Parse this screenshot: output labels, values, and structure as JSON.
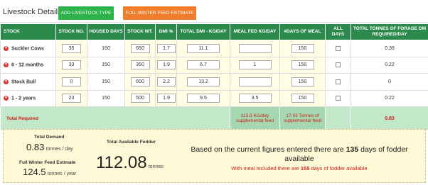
{
  "header": {
    "title": "Livestock Details",
    "add_button": "ADD LIVESTOCK TYPE",
    "estimate_button": "FULL WINTER FEED ESTIMATE"
  },
  "columns": [
    "STOCK",
    "STOCK NO.",
    "HOUSED DAYS",
    "STOCK WT.",
    "DMI %",
    "TOTAL DMI - KG/DAY",
    "MEAL FED KG/DAY",
    "#DAYS OF MEAL",
    "ALL DAYS",
    "TOTAL TONNES OF FORAGE DM REQUIRED/DAY"
  ],
  "rows": [
    {
      "stock": "Suckler Cows",
      "stock_no": "35",
      "housed_days": "150",
      "stock_wt": "650",
      "dmi": "1.7",
      "total_dmi": "11.1",
      "meal_fed": "",
      "days_of_meal": "150",
      "total_tonnes": "0.39"
    },
    {
      "stock": "6 - 12 months",
      "stock_no": "33",
      "housed_days": "150",
      "stock_wt": "350",
      "dmi": "1.9",
      "total_dmi": "6.7",
      "meal_fed": "1",
      "days_of_meal": "150",
      "total_tonnes": "0.22"
    },
    {
      "stock": "Stock Bull",
      "stock_no": "0",
      "housed_days": "150",
      "stock_wt": "600",
      "dmi": "2.2",
      "total_dmi": "13.2",
      "meal_fed": "",
      "days_of_meal": "150",
      "total_tonnes": "0"
    },
    {
      "stock": "1 - 2 years",
      "stock_no": "23",
      "housed_days": "150",
      "stock_wt": "500",
      "dmi": "1.9",
      "total_dmi": "9.5",
      "meal_fed": "3.5",
      "days_of_meal": "150",
      "total_tonnes": "0.22"
    }
  ],
  "totals": {
    "label": "Total Required",
    "meal_supplement": "113.5 KG/day supplemental feed",
    "days_supplement": "17.03 Tonnes of supplemental feed",
    "total_tonnes": "0.83"
  },
  "summary": {
    "demand_label": "Total Demand",
    "demand_value": "0.83",
    "demand_unit": "tonnes / day",
    "estimate_label": "Full Winter Feed Estimate",
    "estimate_value": "124.5",
    "estimate_unit": "tonnes / year",
    "fodder_label": "Total Available Fodder",
    "fodder_value": "112.08",
    "fodder_unit": "tonnes",
    "msg_prefix": "Based on the current figures entered there are",
    "msg_days": "135",
    "msg_suffix": "days of fodder available",
    "sub_prefix": "With meal included there are",
    "sub_days": "155",
    "sub_suffix": "days of fodder available"
  },
  "colors": {
    "header_green": "#2c8a4c",
    "add_button": "#2db34a",
    "estimate_button": "#f07d2b",
    "alert_red": "#d21b1b",
    "total_row": "#c0e8c9",
    "summary_bg": "#fdf9d6"
  },
  "icons": {
    "row_delete": "remove-circle-icon"
  }
}
